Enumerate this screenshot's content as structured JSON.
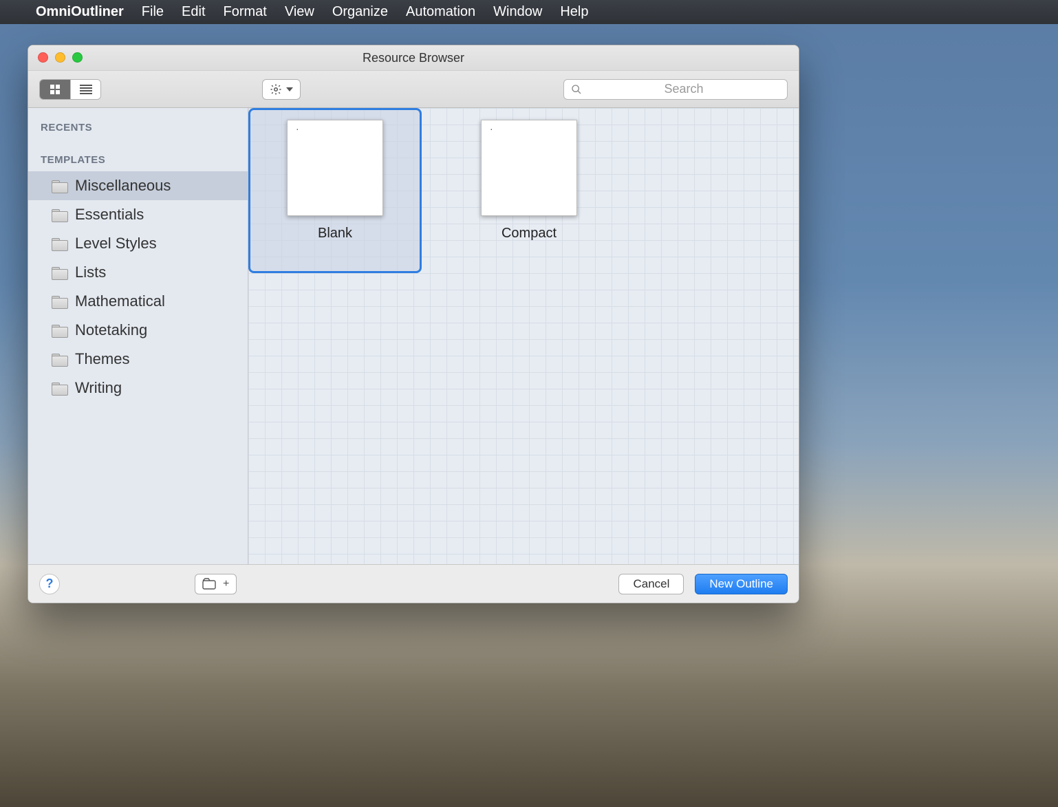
{
  "menubar": {
    "appname": "OmniOutliner",
    "items": [
      "File",
      "Edit",
      "Format",
      "View",
      "Organize",
      "Automation",
      "Window",
      "Help"
    ]
  },
  "window": {
    "title": "Resource Browser"
  },
  "toolbar": {
    "view_mode": "grid",
    "search_placeholder": "Search"
  },
  "sidebar": {
    "sections": {
      "recents_header": "RECENTS",
      "templates_header": "TEMPLATES"
    },
    "templates": [
      {
        "label": "Miscellaneous",
        "selected": true
      },
      {
        "label": "Essentials",
        "selected": false
      },
      {
        "label": "Level Styles",
        "selected": false
      },
      {
        "label": "Lists",
        "selected": false
      },
      {
        "label": "Mathematical",
        "selected": false
      },
      {
        "label": "Notetaking",
        "selected": false
      },
      {
        "label": "Themes",
        "selected": false
      },
      {
        "label": "Writing",
        "selected": false
      }
    ]
  },
  "grid": {
    "items": [
      {
        "label": "Blank",
        "selected": true
      },
      {
        "label": "Compact",
        "selected": false
      }
    ]
  },
  "footer": {
    "cancel_label": "Cancel",
    "confirm_label": "New Outline"
  }
}
